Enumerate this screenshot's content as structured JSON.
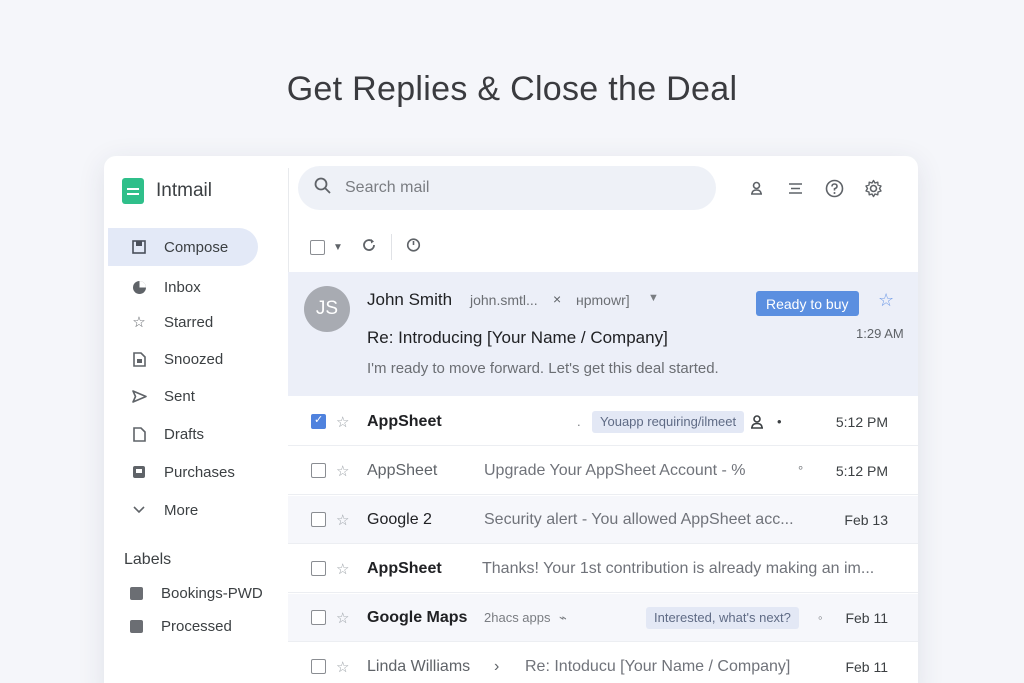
{
  "headline": "Get Replies & Close the Deal",
  "app": {
    "name": "Intmail"
  },
  "sidebar": {
    "compose_label": "Compose",
    "items": [
      {
        "label": "Inbox",
        "icon": "inbox-icon"
      },
      {
        "label": "Starred",
        "icon": "star-icon"
      },
      {
        "label": "Snoozed",
        "icon": "snooze-icon"
      },
      {
        "label": "Sent",
        "icon": "send-icon"
      },
      {
        "label": "Drafts",
        "icon": "draft-icon"
      },
      {
        "label": "Purchases",
        "icon": "purchases-icon"
      },
      {
        "label": "More",
        "icon": "chevron-down-icon"
      }
    ],
    "labels_title": "Labels",
    "labels": [
      "Bookings-PWD",
      "Processed"
    ]
  },
  "search": {
    "placeholder": "Search mail"
  },
  "selected_email": {
    "avatar_initials": "JS",
    "sender": "John Smith",
    "sender_email": "john.smtl...",
    "close_glyph": "×",
    "extra": "нpmowr]",
    "badge": "Ready to buy",
    "subject": "Re: Introducing [Your Name / Company]",
    "snippet": "I'm ready to move forward. Let's get this deal started.",
    "time": "1:29 AM"
  },
  "emails": [
    {
      "sender": "AppSheet",
      "chip": "Youapp requiring/ilmeet",
      "extra": "•",
      "time": "5:12 PM",
      "checked": true
    },
    {
      "sender": "AppSheet",
      "subject": "Upgrade Your AppSheet Account - %",
      "extra": "°",
      "time": "5:12 PM"
    },
    {
      "sender": "Google 2",
      "subject": "Security alert - You allowed AppSheet acc...",
      "time": "Feb 13"
    },
    {
      "sender": "AppSheet",
      "subject": "Thanks! Your 1st contribution is already making an im...",
      "time": ""
    },
    {
      "sender": "Google Maps",
      "small": "2hacs apps",
      "chip": "Interested, what's next?",
      "time": "Feb 11"
    },
    {
      "sender": "Linda Williams",
      "arrow": "›",
      "subject": "Re: Intoducu [Your Name / Company]",
      "time": "Feb 11"
    }
  ],
  "colors": {
    "accent": "#5b8fe0",
    "compose_bg": "#e3e9f7",
    "brand": "#2fbf8a"
  }
}
